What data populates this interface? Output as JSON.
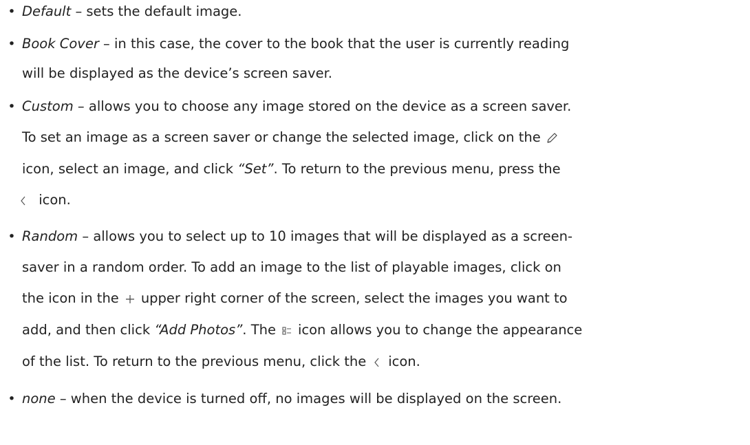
{
  "bullet": "•",
  "icons": {
    "pencil": "pencil-icon",
    "back": "chevron-left-icon",
    "plus": "plus-icon",
    "list_view": "list-view-icon"
  },
  "items": {
    "default": {
      "term": "Default",
      "line1": " – sets the default image."
    },
    "book_cover": {
      "term": "Book Cover",
      "line1": " – in this case, the cover to the book that the user is currently reading",
      "line2": "will be displayed as the device’s screen saver."
    },
    "custom": {
      "term": "Custom",
      "line1": " – allows you to choose any image stored on the device as a screen saver.",
      "line2": "To set an image as a screen saver or change the selected image, click on the",
      "line3_a": "icon, select an image, and click ",
      "line3_set": "“Set”",
      "line3_b": ". To return to the previous menu, press the",
      "line4": "icon."
    },
    "random": {
      "term": "Random",
      "line1": " – allows you to select up to 10 images that will be displayed as a screen-",
      "line2": "saver in a random order. To add an image to the list of playable images, click on",
      "line3_a": "the icon in the",
      "line3_b": "upper right corner of the screen, select the images you want to",
      "line4_a": "add, and then click ",
      "line4_add": "“Add Photos”",
      "line4_b": ". The",
      "line4_c": "icon allows you to change the appearance",
      "line5_a": "of the list. To return to the previous menu, click the",
      "line5_b": "icon."
    },
    "none": {
      "term": "none",
      "line1": " – when the device is turned off, no images will be displayed on the screen."
    }
  }
}
